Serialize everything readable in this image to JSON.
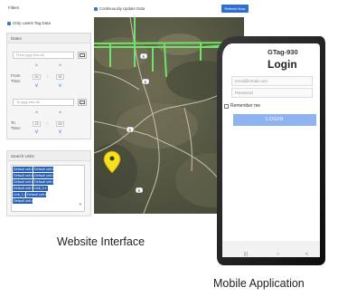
{
  "website": {
    "filters_title": "Filters",
    "only_latest_label": "Only Latest Tag Data",
    "dates": {
      "title": "Dates",
      "from_placeholder": "From yyyy-mm-dd",
      "from_time_label": "From Time:",
      "from_hour": "00",
      "from_minute": "00",
      "to_placeholder": "To yyyy-mm-dd",
      "to_time_label": "To Time:",
      "to_hour": "23",
      "to_minute": "59"
    },
    "search_units": {
      "title": "Search Units",
      "items": [
        "Default unit x",
        "Default unit x",
        "Default unit x",
        "Default unit x",
        "Default unit x",
        "Default unit x",
        "Default unit x",
        "Unit_0 x",
        "Unit_1 x",
        "Default unit x",
        "Default unit x"
      ]
    },
    "continuously_update_label": "Continuously Update Data",
    "refresh_label": "Refresh Now",
    "map": {
      "road_labels": [
        "6",
        "6",
        "6",
        "6"
      ],
      "marker_color": "#f6e11c"
    }
  },
  "mobile": {
    "app_title": "GTag-930",
    "heading": "Login",
    "email_placeholder": "email@email.com",
    "password_placeholder": "Password",
    "remember_label": "Remember me",
    "login_label": "LOGIN",
    "nav": [
      "|||",
      "○",
      "<"
    ]
  },
  "captions": {
    "website": "Website Interface",
    "mobile": "Mobile Application"
  },
  "colors": {
    "primary_blue": "#2f6fd0",
    "selected_unit": "#2b62b8",
    "route_green": "#6fe36a",
    "login_button": "#8fb3ef"
  }
}
